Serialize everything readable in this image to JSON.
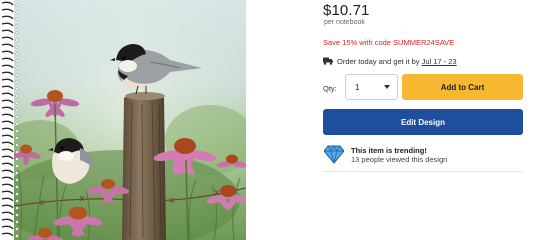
{
  "product": {
    "image_alt": "Spiral notebook with chickadees on a fence post among purple coneflowers"
  },
  "pricing": {
    "price": "$10.71",
    "per_unit": "per notebook",
    "promo": "Save 15% with code SUMMER24SAVE"
  },
  "delivery": {
    "text": "Order today and get it by",
    "date_range": "Jul 17 - 23"
  },
  "purchase": {
    "qty_label": "Qty:",
    "qty_value": "1",
    "add_to_cart_label": "Add to Cart",
    "edit_design_label": "Edit Design"
  },
  "trending": {
    "title": "This item is trending!",
    "subtitle": "13 people viewed this design"
  },
  "colors": {
    "add_to_cart_bg": "#f7b731",
    "edit_design_bg": "#1d4f9c",
    "promo_text": "#e02020"
  },
  "icons": [
    "truck-icon",
    "caret-down-icon",
    "diamond-icon",
    "spiral-binding-icon"
  ]
}
